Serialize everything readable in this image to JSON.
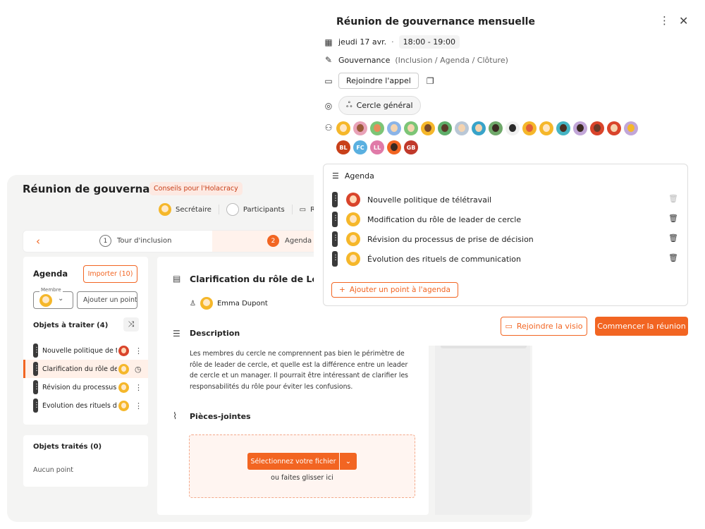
{
  "back": {
    "title": "Réunion de gouvernance",
    "badge": "Conseils pour l'Holacracy",
    "roles": {
      "secretary": "Secrétaire",
      "participants": "Participants",
      "join": "Rejoi"
    },
    "steps": [
      {
        "num": "1",
        "label": "Tour d'inclusion"
      },
      {
        "num": "2",
        "label": "Agenda"
      }
    ],
    "sidebar": {
      "title": "Agenda",
      "import_label": "Importer (10)",
      "member_label": "Membre",
      "add_point_placeholder": "Ajouter un point...",
      "to_process_title": "Objets à traiter (4)",
      "items": [
        {
          "label": "Nouvelle politique de t...",
          "avatar": "red"
        },
        {
          "label": "Clarification du rôle de ...",
          "avatar": "yellow"
        },
        {
          "label": "Révision du processus ...",
          "avatar": "yellow"
        },
        {
          "label": "Évolution des rituels d...",
          "avatar": "yellow"
        }
      ],
      "processed_title": "Objets traités (0)",
      "processed_empty": "Aucun point"
    },
    "detail": {
      "title": "Clarification du rôle de Leader",
      "owner": "Emma Dupont",
      "description_title": "Description",
      "description": "Les membres du cercle ne comprennent pas bien le périmètre de rôle de leader de cercle, et quelle est la différence entre un leader de cercle et un manager. Il pourrait être intéressant de clarifier les responsabilités du rôle pour éviter les confusions.",
      "attachments_title": "Pièces-jointes",
      "select_file": "Sélectionnez votre fichier",
      "drop_hint": "ou faites glisser ici"
    }
  },
  "panel": {
    "title": "Réunion de gouvernance mensuelle",
    "date": "jeudi 17 avr.",
    "separator": "·",
    "time": "18:00 - 19:00",
    "type": "Gouvernance",
    "type_detail": "(Inclusion / Agenda / Clôture)",
    "join_call": "Rejoindre l'appel",
    "circle": "Cercle général",
    "initials": [
      {
        "text": "BL",
        "color": "#c8401a"
      },
      {
        "text": "FC",
        "color": "#5ab0e0"
      },
      {
        "text": "LL",
        "color": "#e07aa8"
      },
      {
        "text": "GB",
        "color": "#c0392b"
      }
    ],
    "agenda": {
      "title": "Agenda",
      "items": [
        {
          "label": "Nouvelle politique de télétravail"
        },
        {
          "label": "Modification du rôle de leader de cercle"
        },
        {
          "label": "Révision du processus de prise de décision"
        },
        {
          "label": "Évolution des rituels de communication"
        }
      ],
      "add_label": "Ajouter un point à l'agenda"
    },
    "join_visio": "Rejoindre la visio",
    "start_meeting": "Commencer la réunion"
  },
  "colors": {
    "accent": "#f26522",
    "badge_bg": "#fde9e2"
  }
}
